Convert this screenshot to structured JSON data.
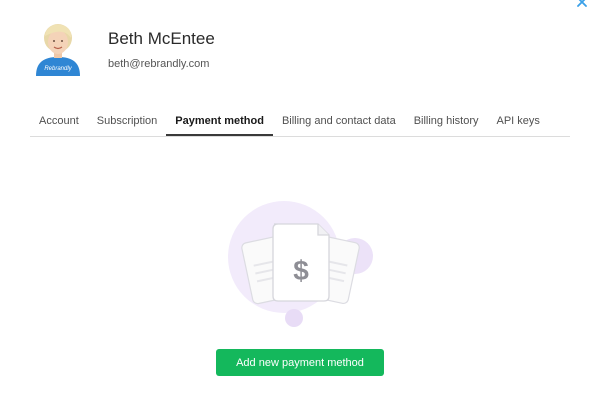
{
  "profile": {
    "name": "Beth McEntee",
    "email": "beth@rebrandly.com",
    "avatar_icon": "user-avatar-photo"
  },
  "tabs": [
    {
      "label": "Account",
      "active": false
    },
    {
      "label": "Subscription",
      "active": false
    },
    {
      "label": "Payment method",
      "active": true
    },
    {
      "label": "Billing and contact data",
      "active": false
    },
    {
      "label": "Billing history",
      "active": false
    },
    {
      "label": "API keys",
      "active": false
    }
  ],
  "empty_state": {
    "icon": "dollar-document-icon",
    "button_label": "Add new payment method"
  },
  "colors": {
    "accent_green": "#14b85c",
    "close_icon": "#3aa0e8",
    "illustration_purple": "#efe6fa"
  }
}
